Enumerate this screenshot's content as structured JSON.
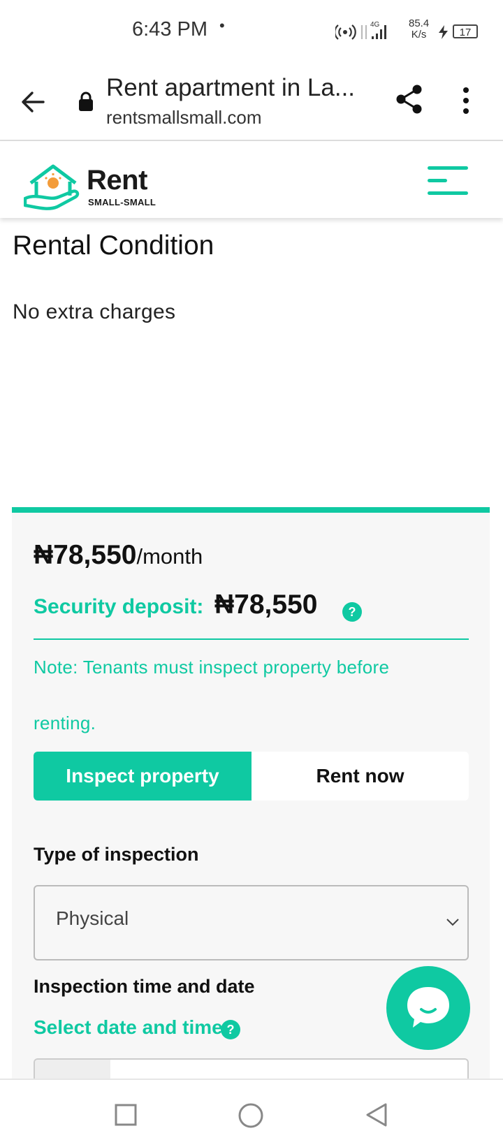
{
  "status_bar": {
    "time": "6:43 PM",
    "dot": "•",
    "network_type": "4G",
    "speed_value": "85.4",
    "speed_unit": "K/s",
    "battery": "17"
  },
  "browser": {
    "title": "Rent apartment in La...",
    "url": "rentsmallsmall.com"
  },
  "site": {
    "logo_main": "Rent",
    "logo_sub": "SMALL-SMALL",
    "accent_color": "#0fc9a2"
  },
  "rental_condition": {
    "heading": "Rental Condition",
    "text": "No extra charges"
  },
  "pricing": {
    "price": "₦78,550",
    "unit": "/month",
    "deposit_label": "Security deposit:",
    "deposit_value": "₦78,550",
    "help_symbol": "?",
    "note_line1": "Note: Tenants must inspect property before",
    "note_line2": "renting."
  },
  "tabs": {
    "inspect": "Inspect property",
    "rent": "Rent now"
  },
  "inspection": {
    "type_label": "Type of inspection",
    "type_value": "Physical",
    "time_label": "Inspection time and date",
    "select_date": "Select date and time"
  }
}
